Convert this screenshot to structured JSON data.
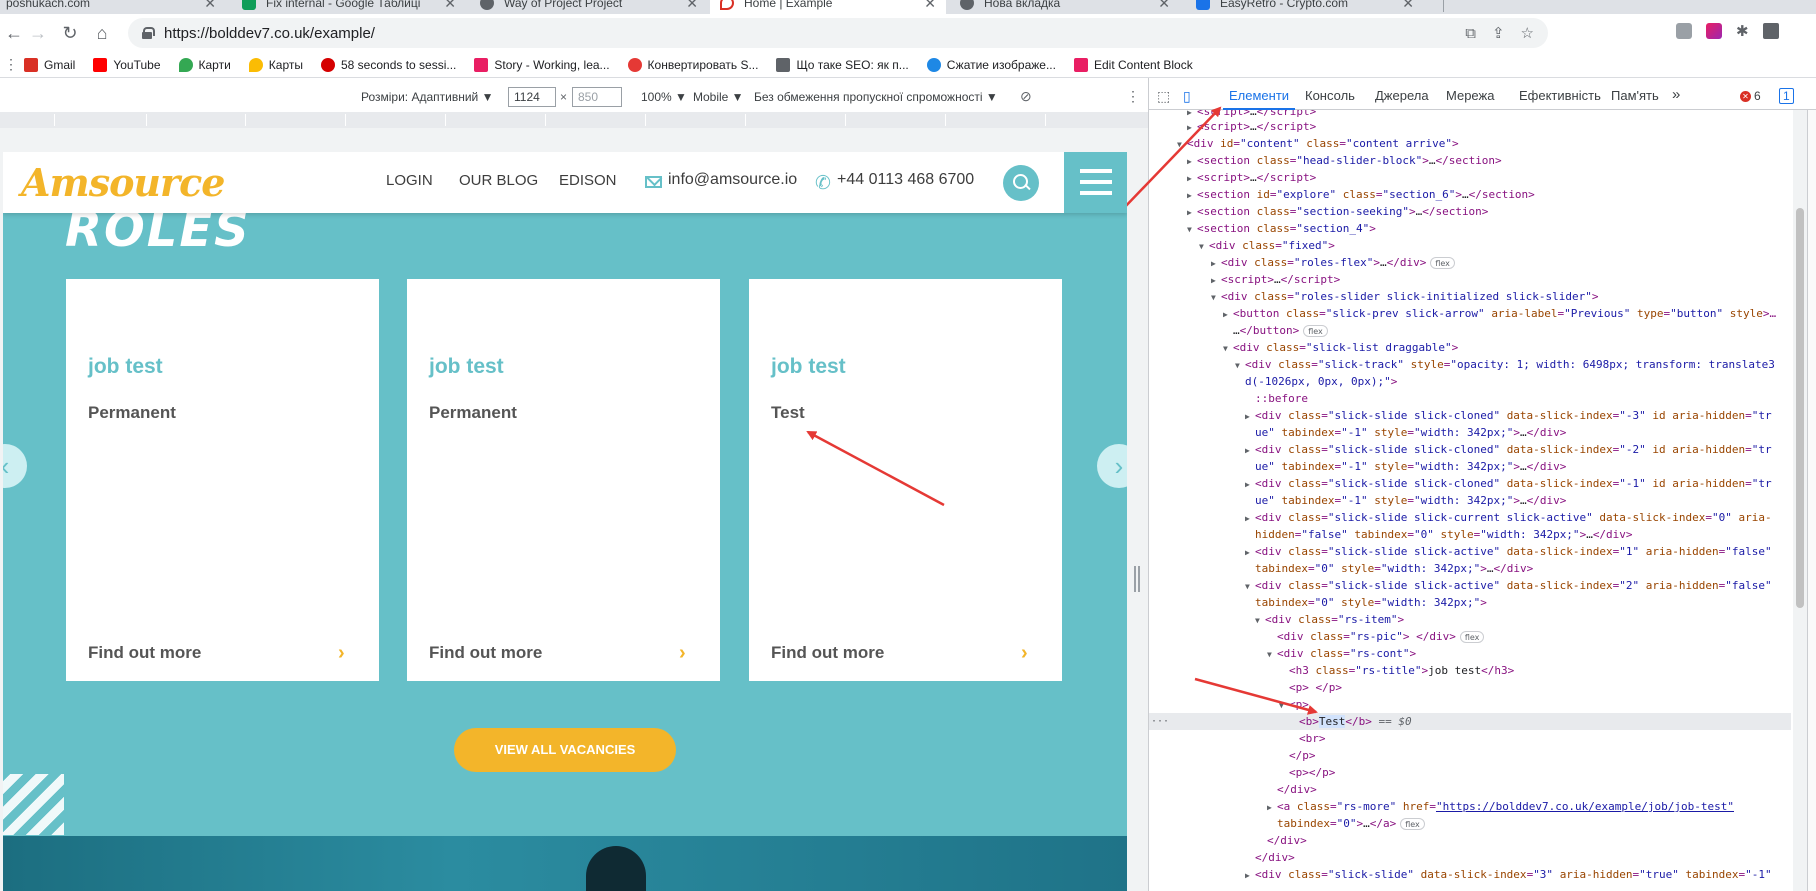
{
  "browser": {
    "tabs": [
      {
        "label": "poshukach.com",
        "color": "#f9ab00"
      },
      {
        "label": "Fix internal - Google Таблиці",
        "color": "#0f9d58"
      },
      {
        "label": "Way of Project Project",
        "color": "#5f6368"
      },
      {
        "label": "Home | Example",
        "color": "#d93025"
      },
      {
        "label": "Нова вкладка",
        "color": "#5f6368"
      },
      {
        "label": "EasyRetro - Crypto.com",
        "color": "#1a73e8"
      }
    ],
    "url": "https://bolddev7.co.uk/example/",
    "bookmarks": [
      {
        "label": "Gmail",
        "color": "#d93025"
      },
      {
        "label": "YouTube",
        "color": "#ff0000"
      },
      {
        "label": "Карти",
        "color": "#34a853"
      },
      {
        "label": "Карты",
        "color": "#fbbc04"
      },
      {
        "label": "58 seconds to sessi...",
        "color": "#d50000"
      },
      {
        "label": "Story - Working, lea...",
        "color": "#e91e63"
      },
      {
        "label": "Конвертировать S...",
        "color": "#e53935"
      },
      {
        "label": "Що таке SEO: як п...",
        "color": "#5f6368"
      },
      {
        "label": "Сжатие изображе...",
        "color": "#1e88e5"
      },
      {
        "label": "Edit Content Block",
        "color": "#e91e63"
      }
    ]
  },
  "device_toolbar": {
    "dimensions_label": "Розміри: Адаптивний ▼",
    "width": "1124",
    "height": "850",
    "zoom": "100% ▼",
    "device": "Mobile ▼",
    "throttle": "Без обмеження пропускної спроможності ▼"
  },
  "site": {
    "logo": "Amsource",
    "nav": [
      "LOGIN",
      "OUR BLOG",
      "EDISON"
    ],
    "email": "info@amsource.io",
    "phone": "+44 0113 468 6700",
    "section_title": "ROLES",
    "cards": [
      {
        "title": "job test",
        "type": "Permanent",
        "more": "Find out more"
      },
      {
        "title": "job test",
        "type": "Permanent",
        "more": "Find out more"
      },
      {
        "title": "job test",
        "type": "Test",
        "more": "Find out more"
      }
    ],
    "view_all": "VIEW ALL VACANCIES"
  },
  "devtools": {
    "tabs": [
      "Елементи",
      "Консоль",
      "Джерела",
      "Мережа",
      "Ефективність",
      "Пам'ять",
      "»"
    ],
    "errors": "6",
    "messages": "1",
    "selected_suffix": "== $0"
  },
  "colors": {
    "teal": "#66c0c8",
    "yellow": "#f3b52a",
    "annotation_red": "#e53935",
    "devtools_blue": "#1a73e8"
  }
}
